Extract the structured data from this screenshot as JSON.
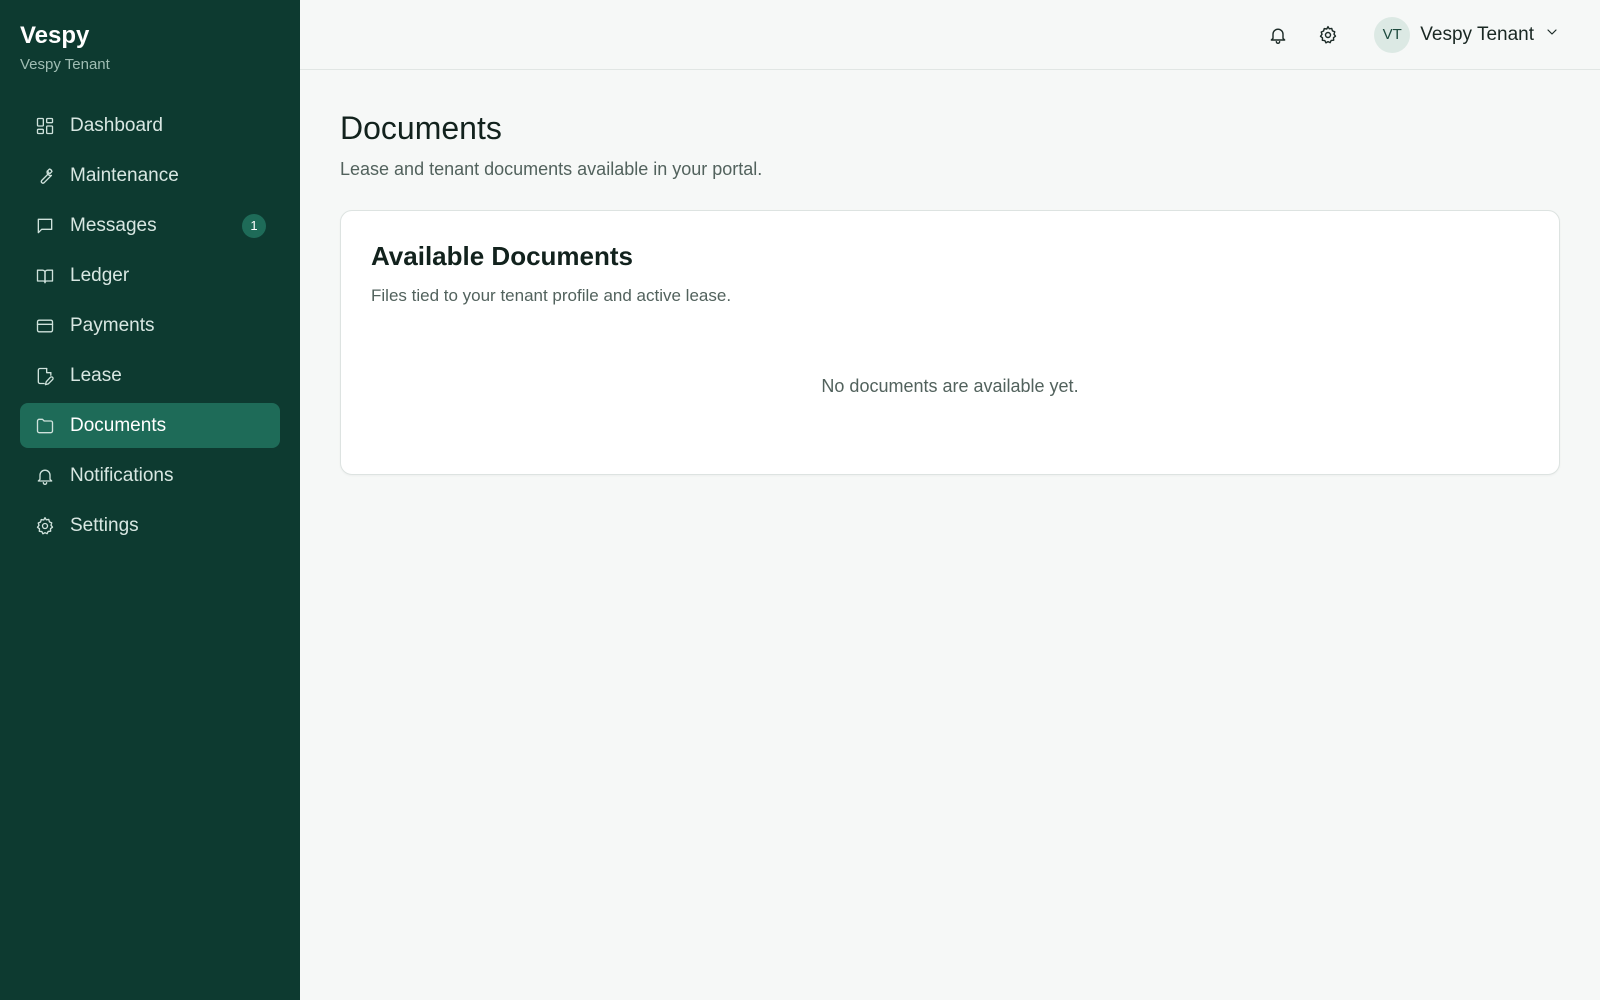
{
  "brand": {
    "title": "Vespy",
    "subtitle": "Vespy Tenant"
  },
  "sidebar": {
    "items": [
      {
        "label": "Dashboard",
        "icon": "dashboard-icon"
      },
      {
        "label": "Maintenance",
        "icon": "wrench-icon"
      },
      {
        "label": "Messages",
        "icon": "message-icon",
        "badge": "1"
      },
      {
        "label": "Ledger",
        "icon": "book-icon"
      },
      {
        "label": "Payments",
        "icon": "credit-card-icon"
      },
      {
        "label": "Lease",
        "icon": "file-edit-icon"
      },
      {
        "label": "Documents",
        "icon": "folder-icon",
        "active": true
      },
      {
        "label": "Notifications",
        "icon": "bell-icon"
      },
      {
        "label": "Settings",
        "icon": "gear-icon"
      }
    ]
  },
  "topbar": {
    "user_initials": "VT",
    "user_name": "Vespy Tenant"
  },
  "page": {
    "title": "Documents",
    "subtitle": "Lease and tenant documents available in your portal."
  },
  "card": {
    "title": "Available Documents",
    "subtitle": "Files tied to your tenant profile and active lease.",
    "empty_message": "No documents are available yet."
  },
  "colors": {
    "sidebar_bg": "#0d3a30",
    "active_item_bg": "#1e6b58",
    "page_bg": "#f6f8f7"
  }
}
